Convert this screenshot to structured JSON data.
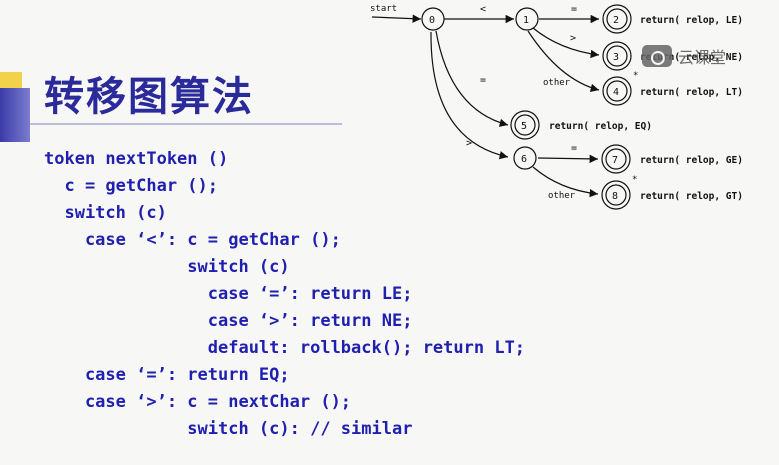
{
  "slide": {
    "title": "转移图算法",
    "code_lines": [
      "token nextToken ()",
      "  c = getChar ();",
      "  switch (c)",
      "    case ‘<’: c = getChar ();",
      "              switch (c)",
      "                case ‘=’: return LE;",
      "                case ‘>’: return NE;",
      "                default: rollback(); return LT;",
      "    case ‘=’: return EQ;",
      "    case ‘>’: c = nextChar ();",
      "              switch (c): // similar"
    ]
  },
  "diagram": {
    "start_label": "start",
    "states": [
      {
        "id": "0",
        "accepting": false
      },
      {
        "id": "1",
        "accepting": false
      },
      {
        "id": "2",
        "accepting": true,
        "action": "return( relop, LE)"
      },
      {
        "id": "3",
        "accepting": true,
        "action": "return( relop, NE)"
      },
      {
        "id": "4",
        "accepting": true,
        "star": "*",
        "action": "return( relop, LT)"
      },
      {
        "id": "5",
        "accepting": true,
        "action": "return( relop, EQ)"
      },
      {
        "id": "6",
        "accepting": false
      },
      {
        "id": "7",
        "accepting": true,
        "action": "return( relop, GE)"
      },
      {
        "id": "8",
        "accepting": true,
        "star": "*",
        "action": "return( relop, GT)"
      }
    ],
    "edge_labels": {
      "e0_1": "<",
      "e1_2": "=",
      "e1_3": ">",
      "e1_4": "other",
      "e0_5": "=",
      "e0_6": ">",
      "e6_7": "=",
      "e6_8": "other"
    }
  },
  "watermark": {
    "text": "云课堂",
    "icon": "cloud-class-logo-icon"
  }
}
